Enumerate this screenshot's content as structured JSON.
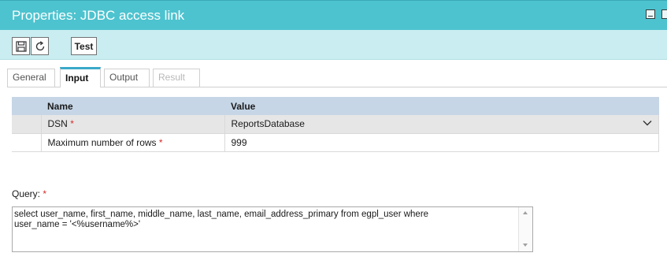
{
  "window": {
    "title": "Properties: JDBC access link"
  },
  "toolbar": {
    "test_label": "Test"
  },
  "tabs": [
    {
      "label": "General"
    },
    {
      "label": "Input"
    },
    {
      "label": "Output"
    },
    {
      "label": "Result"
    }
  ],
  "grid": {
    "headers": {
      "name": "Name",
      "value": "Value"
    },
    "rows": [
      {
        "name": "DSN",
        "required_mark": "*",
        "value": "ReportsDatabase"
      },
      {
        "name": "Maximum number of rows",
        "required_mark": "*",
        "value": "999"
      }
    ]
  },
  "query": {
    "label": "Query:",
    "required_mark": "*",
    "line1": "select user_name, first_name, middle_name, last_name, email_address_primary from egpl_user where",
    "line2": "user_name = '<%username%>'"
  },
  "colors": {
    "titlebar": "#4dc3cf",
    "toolbar": "#c9edf0",
    "tab_accent": "#3aa9c9",
    "header": "#c6d6e6",
    "required": "#d62b2b"
  }
}
